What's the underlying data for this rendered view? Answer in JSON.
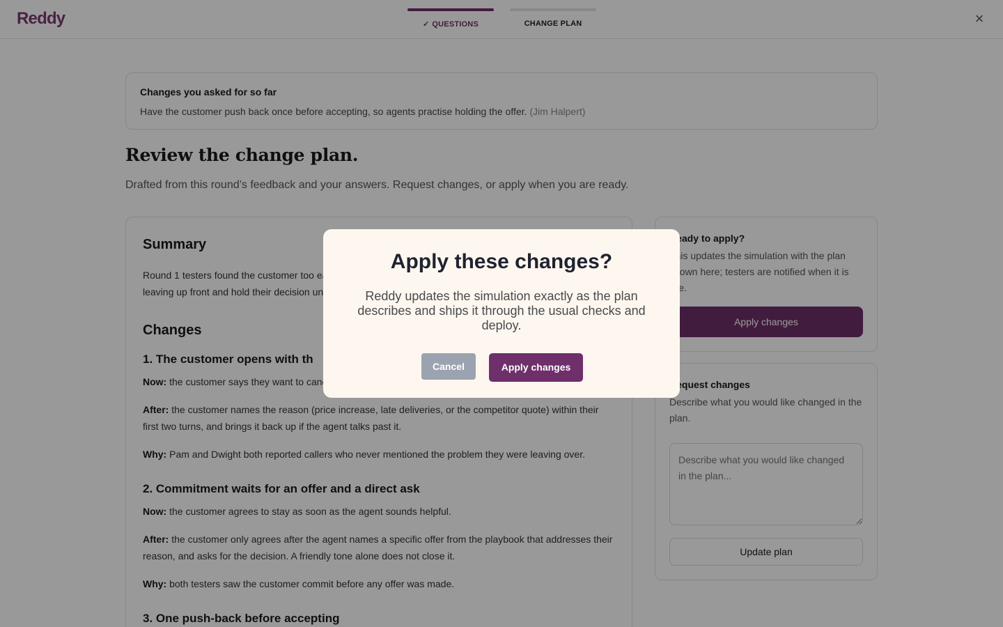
{
  "header": {
    "logo": "Reddy",
    "steps": [
      {
        "label": "QUESTIONS",
        "done": true
      },
      {
        "label": "CHANGE PLAN",
        "done": false
      }
    ],
    "close_glyph": "×"
  },
  "asked": {
    "title": "Changes you asked for so far",
    "text": "Have the customer push back once before accepting, so agents practise holding the offer.",
    "author": "(Jim Halpert)"
  },
  "page": {
    "title": "Review the change plan.",
    "subtitle": "Drafted from this round’s feedback and your answers. Request changes, or apply when you are ready."
  },
  "plan": {
    "summary_heading": "Summary",
    "summary_line1": "Round 1 testers found the customer too ea",
    "summary_line2": "leaving up front and hold their decision un",
    "changes_heading": "Changes",
    "changes": [
      {
        "title": "1. The customer opens with th",
        "now_label": "Now:",
        "now": "the customer says they want to canc",
        "after_label": "After:",
        "after_line1": "the customer names the reason (price increase, late deliveries, or the competitor quote) within their",
        "after_line2": "first two turns, and brings it back up if the agent talks past it.",
        "why_label": "Why:",
        "why": "Pam and Dwight both reported callers who never mentioned the problem they were leaving over."
      },
      {
        "title": "2. Commitment waits for an offer and a direct ask",
        "now_label": "Now:",
        "now": "the customer agrees to stay as soon as the agent sounds helpful.",
        "after_label": "After:",
        "after_line1": "the customer only agrees after the agent names a specific offer from the playbook that addresses their",
        "after_line2": "reason, and asks for the decision. A friendly tone alone does not close it.",
        "why_label": "Why:",
        "why": "both testers saw the customer commit before any offer was made."
      },
      {
        "title": "3. One push-back before accepting"
      }
    ]
  },
  "ready": {
    "title": "Ready to apply?",
    "body": "This updates the simulation with the plan shown here; testers are notified when it is live.",
    "button": "Apply changes"
  },
  "request": {
    "title": "Request changes",
    "body": "Describe what you would like changed in the plan.",
    "placeholder": "Describe what you would like changed in the plan...",
    "button": "Update plan"
  },
  "modal": {
    "title": "Apply these changes?",
    "body": "Reddy updates the simulation exactly as the plan describes and ships it through the usual checks and deploy.",
    "cancel": "Cancel",
    "apply": "Apply changes"
  },
  "icons": {
    "check": "✓"
  },
  "colors": {
    "brand": "#6e2f6a",
    "modal_bg": "#fdf7f0",
    "cancel_bg": "#9ba2b0"
  }
}
